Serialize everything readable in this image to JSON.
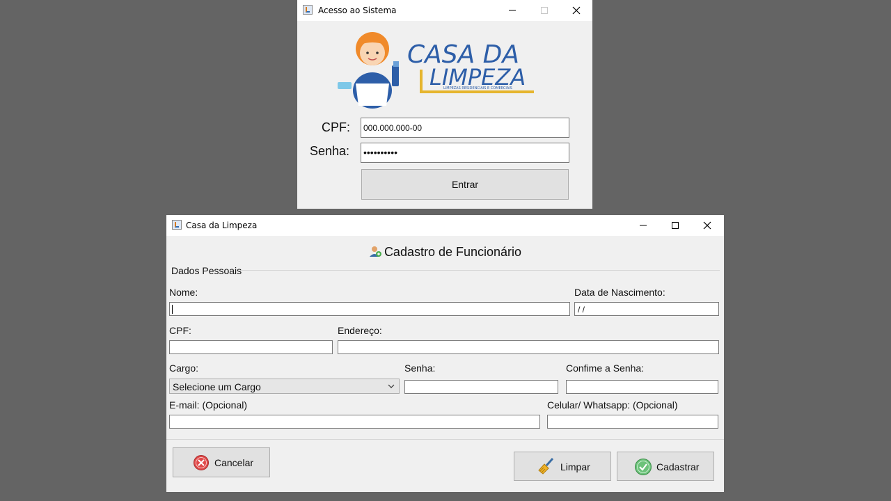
{
  "login_window": {
    "title": "Acesso ao Sistema",
    "logo": {
      "line1": "CASA DA",
      "line2": "LIMPEZA",
      "tagline": "LIMPEZAS RESIDENCIAIS E COMERCIAIS"
    },
    "cpf_label": "CPF:",
    "cpf_value": "000.000.000-00",
    "senha_label": "Senha:",
    "senha_value": "••••••••••",
    "entrar_label": "Entrar"
  },
  "cadastro_window": {
    "title": "Casa da Limpeza",
    "heading": "Cadastro de Funcionário",
    "heading_icon": "user-add-icon",
    "section_title": "Dados Pessoais",
    "fields": {
      "nome": {
        "label": "Nome:",
        "value": ""
      },
      "nascimento": {
        "label": "Data de Nascimento:",
        "value": " / /"
      },
      "cpf": {
        "label": "CPF:",
        "value": "  .   .   -"
      },
      "endereco": {
        "label": "Endereço:",
        "value": ""
      },
      "cargo": {
        "label": "Cargo:",
        "value": "Selecione um Cargo"
      },
      "senha": {
        "label": "Senha:",
        "value": ""
      },
      "confirme": {
        "label": "Confime a Senha:",
        "value": ""
      },
      "email": {
        "label": "E-mail: (Opcional)",
        "value": ""
      },
      "celular": {
        "label": "Celular/ Whatsapp: (Opcional)",
        "value": "( )    -"
      }
    },
    "buttons": {
      "cancelar": "Cancelar",
      "limpar": "Limpar",
      "cadastrar": "Cadastrar"
    },
    "colors": {
      "cancel_red": "#e04848",
      "confirm_green": "#5cb85c"
    }
  }
}
